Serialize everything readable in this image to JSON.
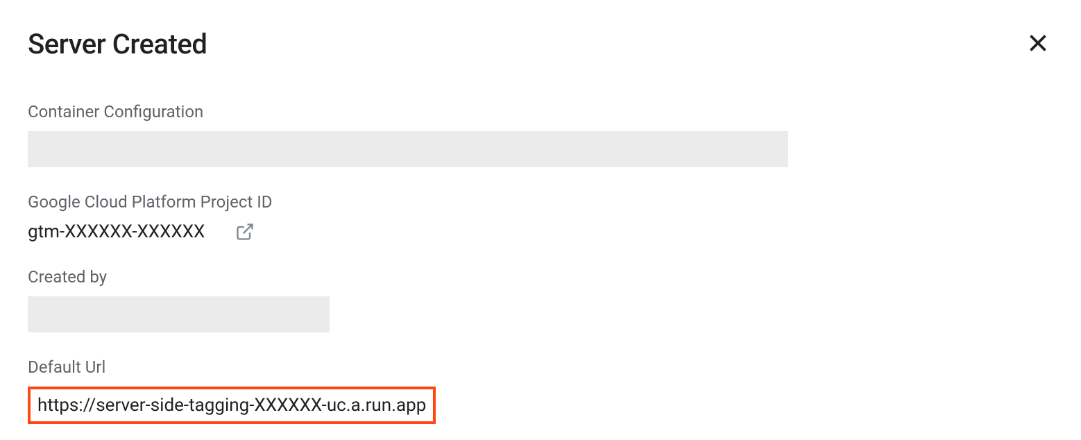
{
  "header": {
    "title": "Server Created"
  },
  "sections": {
    "containerConfig": {
      "label": "Container Configuration"
    },
    "projectId": {
      "label": "Google Cloud Platform Project ID",
      "value": "gtm-XXXXXX-XXXXXX"
    },
    "createdBy": {
      "label": "Created by"
    },
    "defaultUrl": {
      "label": "Default Url",
      "value": "https://server-side-tagging-XXXXXX-uc.a.run.app"
    }
  }
}
